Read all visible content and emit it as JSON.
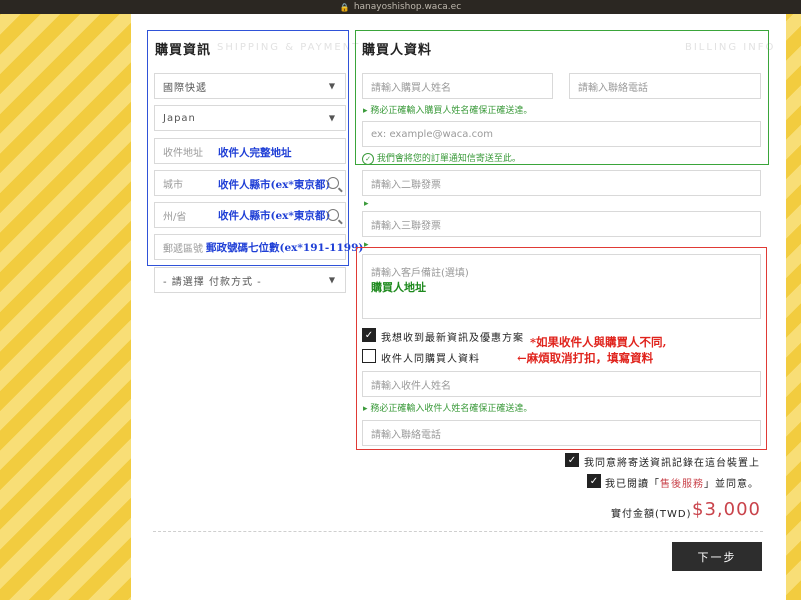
{
  "browser": {
    "url": "hanayoshishop.waca.ec"
  },
  "shipping": {
    "title": "購買資訊",
    "subtitle": "SHIPPING & PAYMENT",
    "shipping_method": "國際快遞",
    "country": "Japan",
    "address_placeholder": "收件地址",
    "address_note": "收件人完整地址",
    "city_placeholder": "城市",
    "city_note": "收件人縣市(ex*東京都)",
    "state_placeholder": "州/省",
    "state_note": "收件人縣市(ex*東京都)",
    "postal_placeholder": "郵遞區號",
    "postal_note": "郵政號碼七位數(ex*191-1199)",
    "payment_method": "- 請選擇 付款方式 -"
  },
  "billing": {
    "title": "購買人資料",
    "subtitle": "BILLING INFO",
    "name_placeholder": "請輸入購買人姓名",
    "phone_placeholder": "請輸入聯絡電話",
    "name_hint": "▸ 務必正確輸入購買人姓名確保正確送達。",
    "email_placeholder": "ex: example@waca.com",
    "email_hint": "我們會將您的訂單通知信寄送至此。",
    "invoice2_placeholder": "請輸入二聯發票",
    "invoice3_placeholder": "請輸入三聯發票",
    "arrow": "▸"
  },
  "notes": {
    "remark_placeholder": "請輸入客戶備註(選填)",
    "remark_note": "購買人地址",
    "newsletter_label": "我想收到最新資訊及優惠方案",
    "newsletter_checked": true,
    "same_as_buyer_label": "收件人同購買人資料",
    "same_as_buyer_checked": false,
    "annotation_line1": "*如果收件人與購買人不同,",
    "annotation_line2": "←麻煩取消打扣，填寫資料",
    "receiver_name_placeholder": "請輸入收件人姓名",
    "receiver_hint": "▸ 務必正確輸入收件人姓名確保正確送達。",
    "receiver_phone_placeholder": "請輸入聯絡電話"
  },
  "agreements": {
    "save_record_label": "我同意將寄送資訊記錄在這台裝置上",
    "terms_prefix": "我已閱讀「",
    "terms_link": "售後服務",
    "terms_suffix": "」並同意。"
  },
  "total": {
    "label": "實付金額(TWD)",
    "amount": "$3,000"
  },
  "next_button": "下一步",
  "colors": {
    "accent_red": "#c9434b",
    "stripe_yellow": "#f2cc3f",
    "green_hint": "#3a9a3a"
  }
}
